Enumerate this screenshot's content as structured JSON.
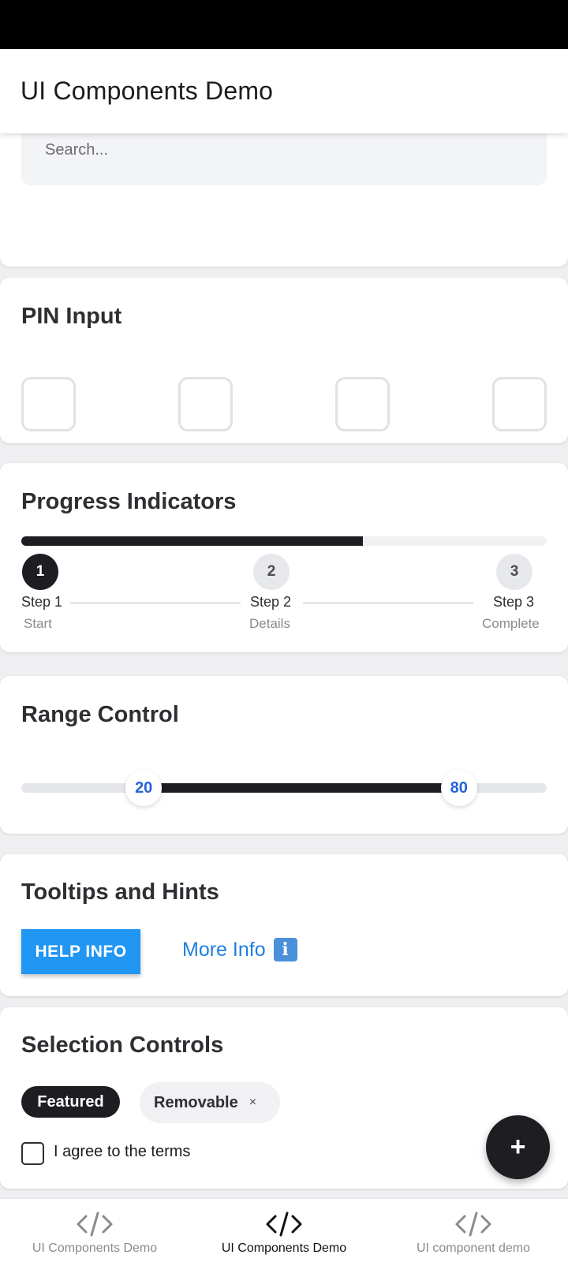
{
  "app": {
    "title": "UI Components Demo"
  },
  "search": {
    "placeholder": "Search..."
  },
  "pin_section": {
    "title": "PIN Input",
    "boxes": [
      "",
      "",
      "",
      ""
    ]
  },
  "progress_section": {
    "title": "Progress Indicators",
    "progress_value": 0.65,
    "steps": [
      {
        "number": "1",
        "label": "Step 1",
        "sub": "Start",
        "active": true
      },
      {
        "number": "2",
        "label": "Step 2",
        "sub": "Details",
        "active": false
      },
      {
        "number": "3",
        "label": "Step 3",
        "sub": "Complete",
        "active": false
      }
    ]
  },
  "range_section": {
    "title": "Range Control",
    "min_value": "20",
    "max_value": "80",
    "range_min": 0,
    "range_max": 100
  },
  "tooltips_section": {
    "title": "Tooltips and Hints",
    "help_button": "HELP INFO",
    "more_info": "More Info",
    "info_icon": "info-icon"
  },
  "selection_section": {
    "title": "Selection Controls",
    "chip_featured": "Featured",
    "chip_removable": "Removable",
    "chip_close": "×",
    "checkbox_label": "I agree to the terms",
    "checkbox_checked": false
  },
  "fab": {
    "label": "+"
  },
  "bottom_nav": {
    "items": [
      {
        "label": "UI Components Demo",
        "icon": "code-icon",
        "active": false
      },
      {
        "label": "UI Components Demo",
        "icon": "code-icon",
        "active": true
      },
      {
        "label": "UI component demo",
        "icon": "code-icon",
        "active": false
      }
    ]
  },
  "colors": {
    "accent": "#2196f3",
    "dark": "#1e1e22",
    "link": "#1f7fe0",
    "range_value": "#2563d6"
  }
}
